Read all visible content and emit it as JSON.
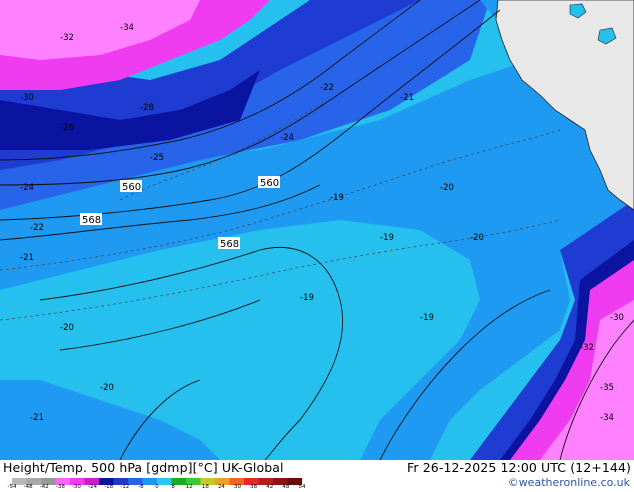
{
  "product": {
    "parameter": "Height/Temp. 500 hPa [gdmp][°C]",
    "model": "UK-Global",
    "valid_time": "Fr 26-12-2025 12:00 UTC (12+144)"
  },
  "credit": "©weatheronline.co.uk",
  "colorbar": {
    "stops": [
      "#b8b8b8",
      "#a8a8a8",
      "#989898",
      "#fe64ff",
      "#f03cf0",
      "#c81ec8",
      "#0a1496",
      "#1e3cc8",
      "#2864e6",
      "#1e96f0",
      "#28c8f0",
      "#1eaa28",
      "#3cc83c",
      "#c8c828",
      "#f0a028",
      "#f06428",
      "#e62828",
      "#b41e1e",
      "#8c1414",
      "#6e0a0a"
    ],
    "labels": [
      "-54",
      "-48",
      "-42",
      "-38",
      "-30",
      "-24",
      "-18",
      "-12",
      "-8",
      "0",
      "8",
      "12",
      "18",
      "24",
      "30",
      "38",
      "42",
      "48",
      "54"
    ]
  },
  "map_labels": {
    "contours": [
      "560",
      "560",
      "568",
      "568"
    ],
    "temps": [
      "-19",
      "-20",
      "-21",
      "-22",
      "-24",
      "-25",
      "-26",
      "-28",
      "-30",
      "-32",
      "-34",
      "-35"
    ]
  },
  "colors": {
    "ocean_deep": "#0a14a0",
    "band_cold": "#1e3cd2",
    "band_mid": "#2864ea",
    "band_warm": "#1e9af2",
    "band_light": "#26c0ef",
    "band_magenta": "#f03cf0",
    "band_pink": "#fe82ff",
    "land": "#e8e8e8",
    "coast": "#202020",
    "contour": "#111111"
  }
}
